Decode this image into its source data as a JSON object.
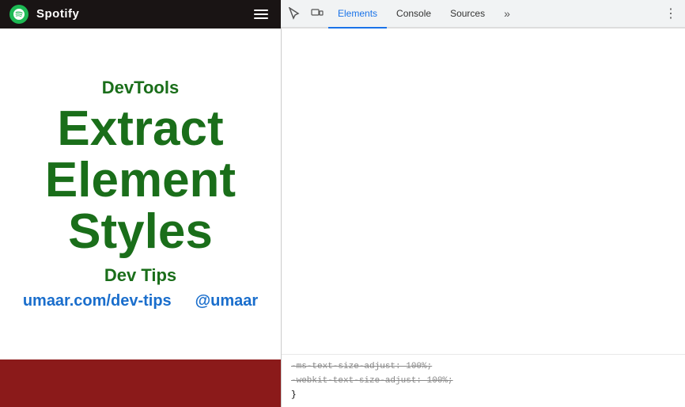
{
  "spotify": {
    "logo_label": "Spotify",
    "hamburger_label": "Menu"
  },
  "devtools": {
    "tabs": [
      {
        "id": "elements",
        "label": "Elements",
        "active": true
      },
      {
        "id": "console",
        "label": "Console",
        "active": false
      },
      {
        "id": "sources",
        "label": "Sources",
        "active": false
      }
    ],
    "more_tabs_icon": "»",
    "kebab_icon": "⋮",
    "inspect_icon": "⬚",
    "device_icon": "▱"
  },
  "content": {
    "devtools_label": "DevTools",
    "main_title_line1": "Extract Element",
    "main_title_line2": "Styles",
    "dev_tips_label": "Dev Tips",
    "link_url": "umaar.com/dev-tips",
    "link_twitter": "@umaar"
  },
  "code": {
    "line1": "-ms-text-size-adjust: 100%;",
    "line2": "-webkit-text-size-adjust: 100%;",
    "line3": "}"
  }
}
